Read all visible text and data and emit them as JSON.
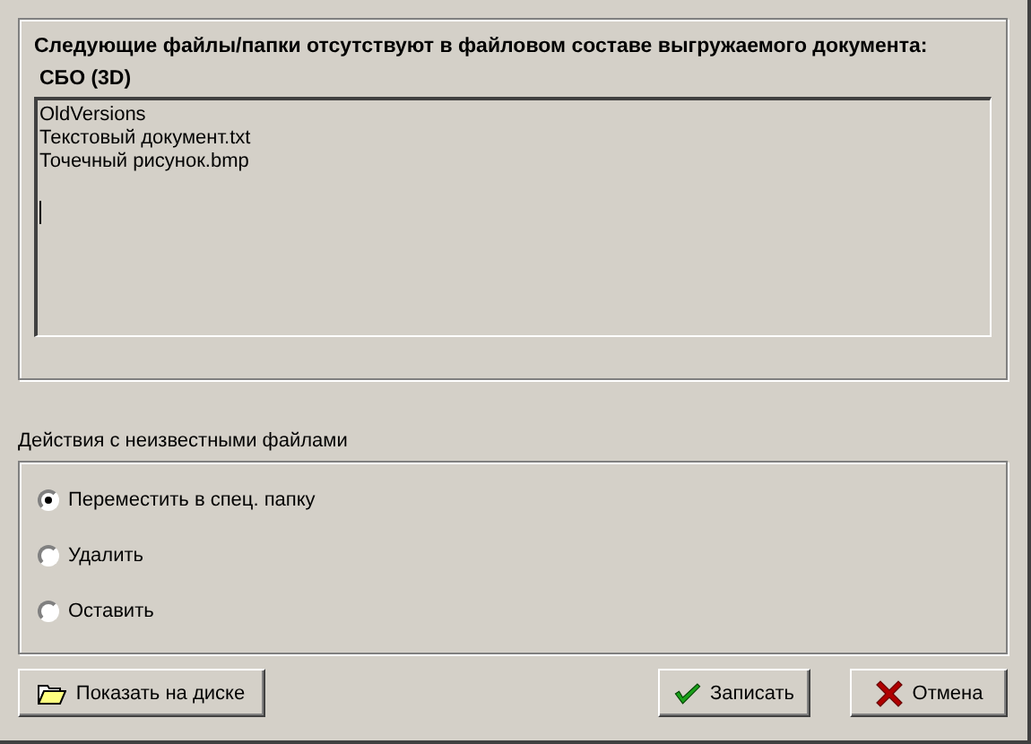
{
  "header": {
    "message": "Следующие файлы/папки отсутствуют в файловом составе выгружаемого документа:",
    "document": "СБО (3D)"
  },
  "files": [
    "OldVersions",
    "Текстовый документ.txt",
    "Точечный рисунок.bmp"
  ],
  "actions": {
    "label": "Действия с неизвестными файлами",
    "options": [
      {
        "label": "Переместить в спец. папку",
        "selected": true
      },
      {
        "label": "Удалить",
        "selected": false
      },
      {
        "label": "Оставить",
        "selected": false
      }
    ]
  },
  "buttons": [
    {
      "kind": "folder",
      "label": "Показать на диске"
    },
    {
      "kind": "ok",
      "label": "Записать"
    },
    {
      "kind": "cancel",
      "label": "Отмена"
    }
  ]
}
